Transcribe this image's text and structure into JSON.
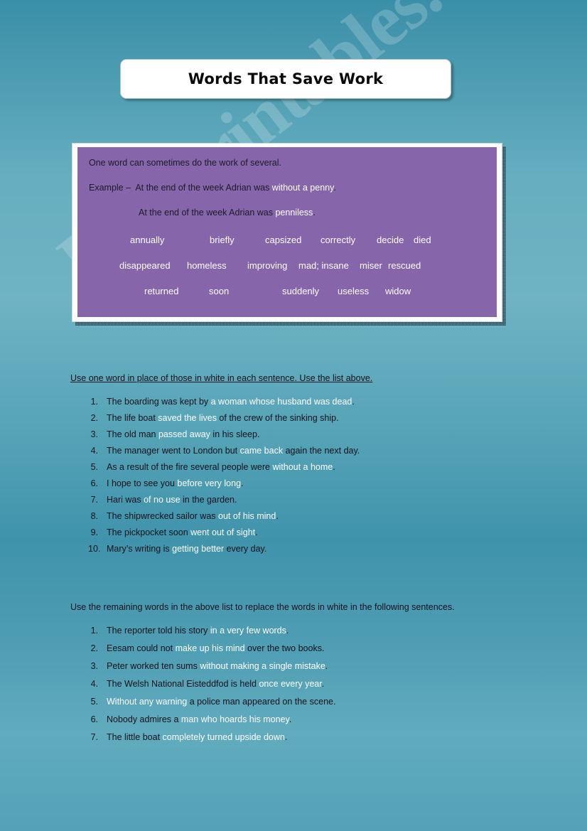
{
  "page": {
    "title": "Words That Save Work",
    "watermark": "ESLprintables.com",
    "background_top_color": "#3a8fa8",
    "background_mid_color": "#6fb3c4",
    "panel_color": "#8665ab",
    "highlight_color": "#ffffff",
    "text_color": "#12121c"
  },
  "panel": {
    "line1": "One word can sometimes do the work of several.",
    "example": {
      "label": "Example –  At the end of the week Adrian was ",
      "highlight": "without a penny",
      "tail": "."
    },
    "answer": {
      "label": "At the end of the week Adrian was ",
      "highlight": "penniless",
      "tail": "."
    },
    "word_rows": [
      [
        "annually",
        "briefly",
        "capsized",
        "correctly",
        "decide",
        "died"
      ],
      [
        "disappeared",
        "homeless",
        "improving",
        "mad; insane",
        "miser",
        "rescued"
      ],
      [
        "returned",
        "soon",
        "suddenly",
        "useless",
        "widow"
      ]
    ]
  },
  "section1": {
    "instruction": "Use one word in place of those in white in each sentence. Use the list above.",
    "items": [
      {
        "num": "1.",
        "pre": "The boarding was kept by ",
        "hl": "a woman whose husband was dead",
        "post": "."
      },
      {
        "num": "2.",
        "pre": "The life boat ",
        "hl": "saved the lives",
        "post": " of the crew of the sinking ship."
      },
      {
        "num": "3.",
        "pre": "The old man ",
        "hl": "passed away",
        "post": " in his sleep."
      },
      {
        "num": "4.",
        "pre": "The manager went to London but ",
        "hl": "came back",
        "post": " again the next day."
      },
      {
        "num": "5.",
        "pre": "As a result of the fire several people were ",
        "hl": "without a home",
        "post": "."
      },
      {
        "num": "6.",
        "pre": "I hope to see you ",
        "hl": "before very long",
        "post": "."
      },
      {
        "num": "7.",
        "pre": "Hari was ",
        "hl": "of no use",
        "post": " in the garden."
      },
      {
        "num": "8.",
        "pre": "The shipwrecked sailor was ",
        "hl": "out of his mind",
        "post": "."
      },
      {
        "num": "9.",
        "pre": "The pickpocket soon ",
        "hl": "went out of sight",
        "post": "."
      },
      {
        "num": "10.",
        "pre": "Mary’s writing is ",
        "hl": "getting better",
        "post": " every day."
      }
    ]
  },
  "section2": {
    "instruction": "Use the remaining words in the above list to replace the words in white in the following sentences.",
    "items": [
      {
        "num": "1.",
        "pre": "The reporter told his story ",
        "hl": "in a very few words",
        "post": "."
      },
      {
        "num": "2.",
        "pre": "Eesam could not ",
        "hl": "make up his mind",
        "post": " over the two books."
      },
      {
        "num": "3.",
        "pre": "Peter worked ten sums ",
        "hl": "without making a single mistake",
        "post": "."
      },
      {
        "num": "4.",
        "pre": "The Welsh National Eisteddfod is held ",
        "hl": "once every year",
        "post": "."
      },
      {
        "num": "5.",
        "pre": "",
        "hl": "Without any warning",
        "post": " a police man appeared on the scene."
      },
      {
        "num": "6.",
        "pre": "Nobody admires a ",
        "hl": "man who hoards his money",
        "post": "."
      },
      {
        "num": "7.",
        "pre": "The little boat ",
        "hl": "completely turned upside down",
        "post": "."
      }
    ]
  }
}
